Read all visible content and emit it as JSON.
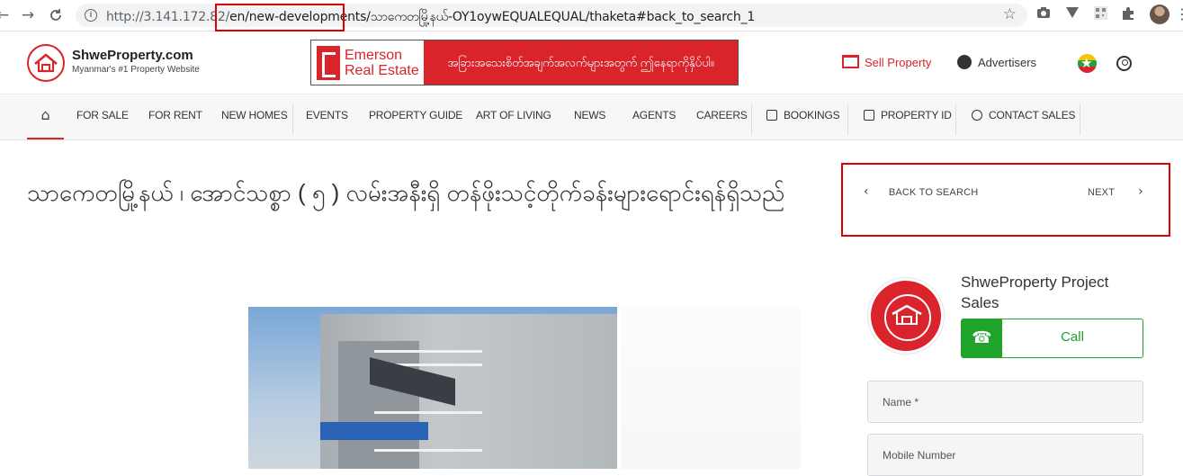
{
  "browser": {
    "back": "←",
    "forward": "→",
    "reload": "C",
    "url_host": "http://3.141.172.82/",
    "url_path": "en/new-developments/သာကေတမြို့နယ်-OY1oywEQUALEQUAL/thaketa#back_to_search_1",
    "star": "☆",
    "menu": "⋮"
  },
  "header": {
    "logo_title": "ShweProperty.com",
    "logo_tagline": "Myanmar's #1 Property Website",
    "banner_brand_line1": "Emerson",
    "banner_brand_line2": "Real Estate",
    "banner_text": "အခြားအသေးစိတ်အချက်အလက်များအတွက် ဤနေရာကိုနှိပ်ပါ။",
    "sell_label": "Sell Property",
    "advertisers_label": "Advertisers"
  },
  "nav": {
    "home_icon": "⌂",
    "items": [
      "FOR SALE",
      "FOR RENT",
      "NEW HOMES",
      "EVENTS",
      "PROPERTY GUIDE",
      "ART OF LIVING",
      "NEWS",
      "AGENTS",
      "CAREERS",
      "BOOKINGS",
      "PROPERTY ID",
      "CONTACT SALES"
    ]
  },
  "listing": {
    "title": "သာကေတမြို့နယ် ၊ အောင်သစ္စာ ( ၅ ) လမ်းအနီးရှိ တန်ဖိုးသင့်တိုက်ခန်းများရောင်းရန်ရှိသည်",
    "back_label": "BACK TO SEARCH",
    "next_label": "NEXT",
    "prev_chevron": "‹",
    "next_chevron": "›"
  },
  "agent": {
    "name": "ShweProperty Project Sales",
    "call_label": "Call",
    "call_icon": "☎",
    "name_placeholder": "Name *",
    "mobile_placeholder": "Mobile Number"
  },
  "colors": {
    "brand_red": "#d9242b",
    "call_green": "#1fa32b",
    "highlight_box": "#e00000"
  }
}
